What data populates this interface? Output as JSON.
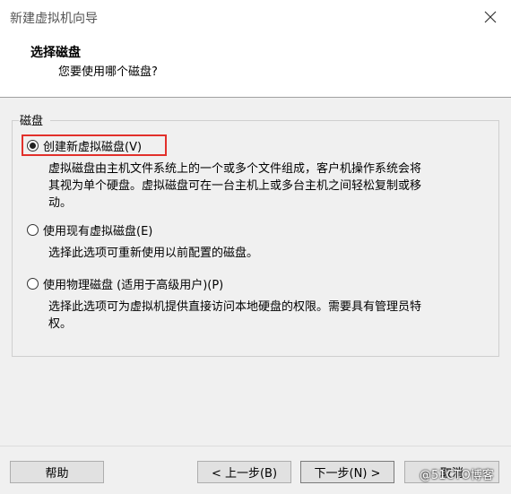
{
  "window": {
    "title": "新建虚拟机向导"
  },
  "header": {
    "title": "选择磁盘",
    "subtitle": "您要使用哪个磁盘?"
  },
  "group": {
    "legend": "磁盘"
  },
  "options": [
    {
      "label": "创建新虚拟磁盘(V)",
      "selected": true,
      "desc_lines": [
        "虚拟磁盘由主机文件系统上的一个或多个文件组成，客户机操作系统会将",
        "其视为单个硬盘。虚拟磁盘可在一台主机上或多台主机之间轻松复制或移",
        "动。"
      ]
    },
    {
      "label": "使用现有虚拟磁盘(E)",
      "selected": false,
      "desc_lines": [
        "选择此选项可重新使用以前配置的磁盘。"
      ]
    },
    {
      "label": "使用物理磁盘 (适用于高级用户)(P)",
      "selected": false,
      "desc_lines": [
        "选择此选项可为虚拟机提供直接访问本地硬盘的权限。需要具有管理员特",
        "权。"
      ]
    }
  ],
  "buttons": {
    "help": "帮助",
    "back": "< 上一步(B)",
    "next": "下一步(N) >",
    "cancel": "取消"
  },
  "watermark": "@51CTO博客"
}
